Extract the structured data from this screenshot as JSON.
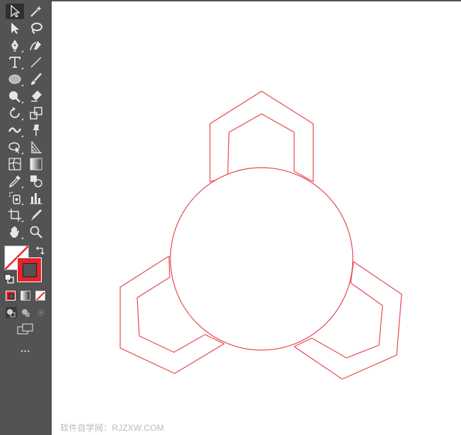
{
  "toolbar": {
    "tools": [
      {
        "icon": "selection-icon",
        "active": true
      },
      {
        "icon": "magic-wand-icon"
      },
      {
        "icon": "direct-selection-icon"
      },
      {
        "icon": "lasso-icon"
      },
      {
        "icon": "pen-icon"
      },
      {
        "icon": "curvature-icon"
      },
      {
        "icon": "type-icon"
      },
      {
        "icon": "line-segment-icon"
      },
      {
        "icon": "ellipse-icon"
      },
      {
        "icon": "paintbrush-icon"
      },
      {
        "icon": "shaper-icon"
      },
      {
        "icon": "eraser-icon"
      },
      {
        "icon": "rotate-icon"
      },
      {
        "icon": "scale-icon"
      },
      {
        "icon": "warp-icon"
      },
      {
        "icon": "puppet-warp-icon"
      },
      {
        "icon": "shape-builder-icon"
      },
      {
        "icon": "perspective-grid-icon"
      },
      {
        "icon": "mesh-icon"
      },
      {
        "icon": "gradient-icon"
      },
      {
        "icon": "eyedropper-icon"
      },
      {
        "icon": "blend-icon"
      },
      {
        "icon": "symbol-sprayer-icon"
      },
      {
        "icon": "column-graph-icon"
      },
      {
        "icon": "artboard-icon"
      },
      {
        "icon": "slice-icon"
      },
      {
        "icon": "hand-icon"
      },
      {
        "icon": "zoom-icon"
      }
    ],
    "fill_stroke": {
      "fill_color": "#ffffff",
      "stroke_color": "#e5232b",
      "swap_icon": "swap-fill-stroke-icon",
      "default_icon": "default-fill-stroke-icon"
    },
    "color_modes": [
      "color-icon",
      "gradient-mode-icon",
      "none-icon"
    ],
    "draw_modes": [
      "draw-normal-icon",
      "draw-behind-icon",
      "draw-inside-icon"
    ],
    "screen_mode_icon": "change-screen-mode-icon",
    "more_label": "···"
  },
  "artwork": {
    "stroke_color": "#e8474f",
    "shapes": [
      "hexagon-top",
      "hexagon-left",
      "hexagon-right",
      "center-circle"
    ]
  },
  "watermark": "软件自学网：RJZXW.COM",
  "colors": {
    "toolbar_bg": "#535353",
    "canvas_bg": "#ffffff",
    "accent_red": "#e5232b"
  }
}
